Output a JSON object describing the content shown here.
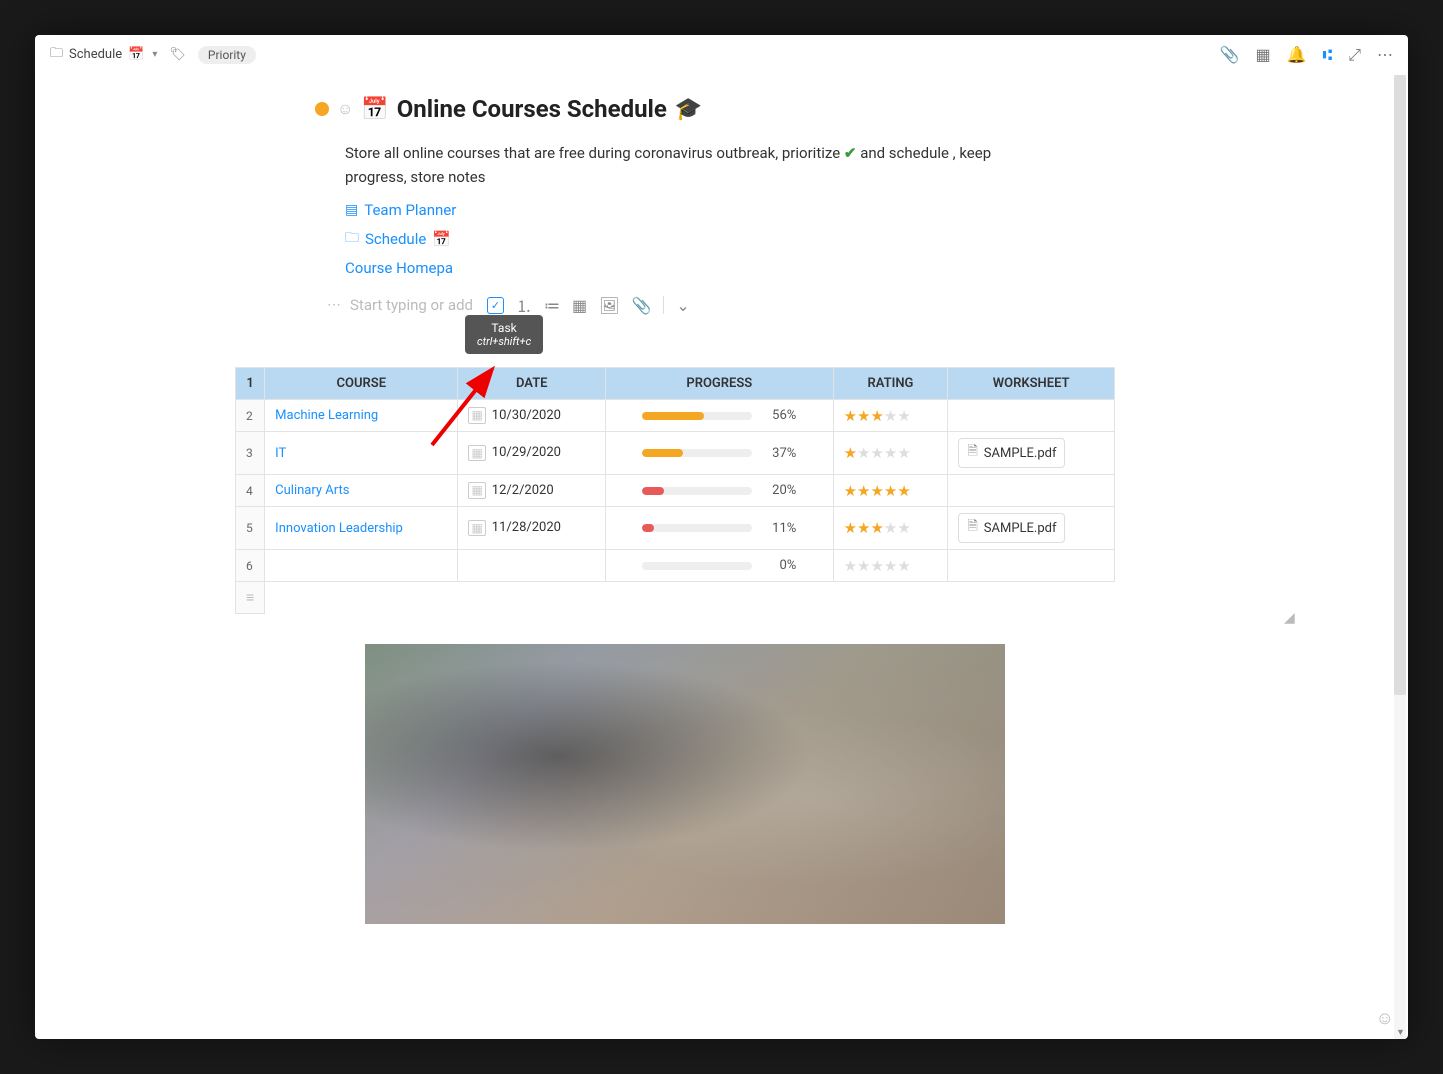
{
  "topbar": {
    "folder_label": "Schedule",
    "priority_label": "Priority"
  },
  "header": {
    "title": "Online Courses Schedule",
    "title_emoji": "🎓",
    "calendar_emoji": "📅",
    "description_part1": "Store all online courses that are free during coronavirus outbreak, prioritize ",
    "description_part2": " and schedule , keep progress, store notes"
  },
  "links": {
    "team_planner": "Team Planner",
    "schedule": "Schedule",
    "course_homepage": "Course Homepa"
  },
  "editor": {
    "placeholder": "Start typing or add"
  },
  "tooltip": {
    "title": "Task",
    "shortcut": "ctrl+shift+c"
  },
  "table": {
    "headers": [
      "COURSE",
      "DATE",
      "PROGRESS",
      "RATING",
      "WORKSHEET"
    ],
    "rows": [
      {
        "num": "1",
        "course": "Machine Learning",
        "date": "10/30/2020",
        "progress": 56,
        "color": "#f5a623",
        "rating": 3,
        "worksheet": ""
      },
      {
        "num": "2",
        "course": "IT",
        "date": "10/29/2020",
        "progress": 37,
        "color": "#f5a623",
        "rating": 1,
        "worksheet": "SAMPLE.pdf"
      },
      {
        "num": "3",
        "course": "Culinary Arts",
        "date": "12/2/2020",
        "progress": 20,
        "color": "#e85a5a",
        "rating": 5,
        "worksheet": ""
      },
      {
        "num": "4",
        "course": "Innovation Leadership",
        "date": "11/28/2020",
        "progress": 11,
        "color": "#e85a5a",
        "rating": 3,
        "worksheet": "SAMPLE.pdf"
      },
      {
        "num": "5",
        "course": "",
        "date": "",
        "progress": 0,
        "color": "#eee",
        "rating": 0,
        "worksheet": ""
      }
    ],
    "extra_row_num": "6"
  }
}
